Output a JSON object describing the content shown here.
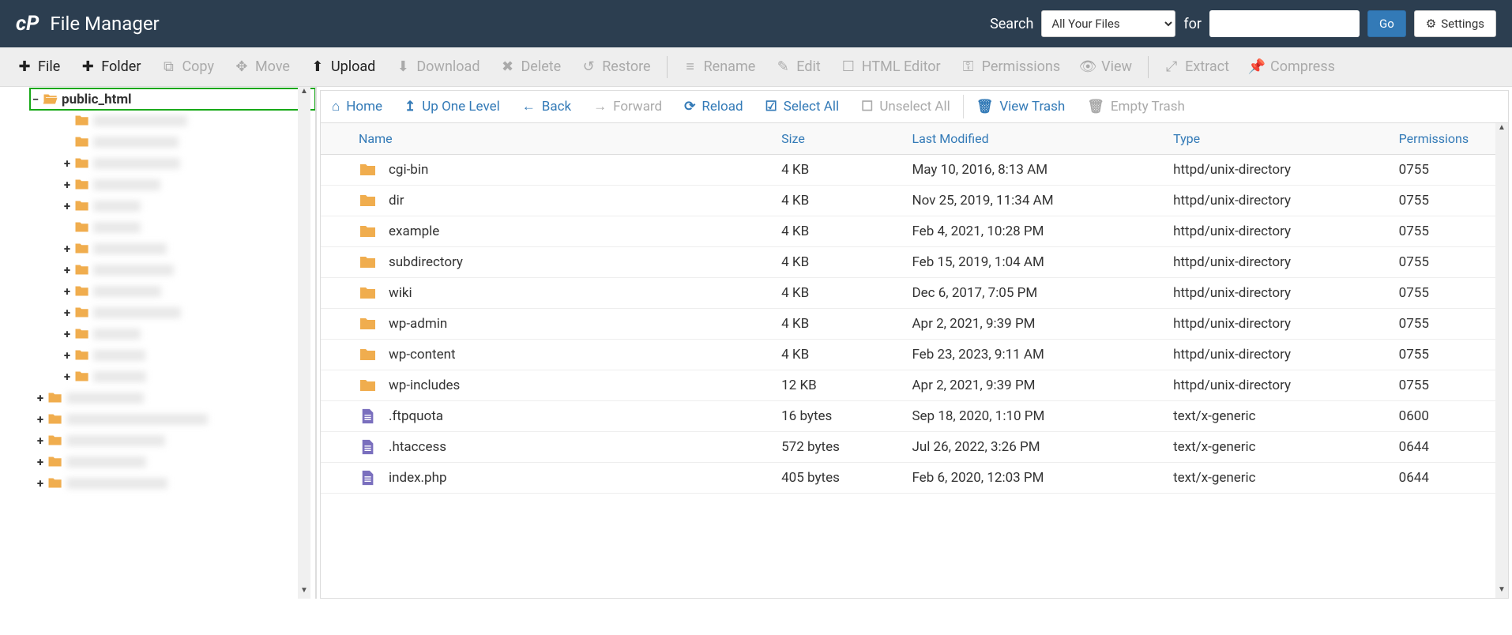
{
  "header": {
    "title": "File Manager",
    "search_label": "Search",
    "for_label": "for",
    "search_value": "",
    "go_label": "Go",
    "settings_label": "Settings",
    "dropdown_selected": "All Your Files"
  },
  "toolbar": [
    {
      "id": "file",
      "label": "File",
      "icon": "plus",
      "enabled": true
    },
    {
      "id": "folder",
      "label": "Folder",
      "icon": "plus",
      "enabled": true
    },
    {
      "id": "copy",
      "label": "Copy",
      "icon": "copy",
      "enabled": false
    },
    {
      "id": "move",
      "label": "Move",
      "icon": "move",
      "enabled": false
    },
    {
      "id": "upload",
      "label": "Upload",
      "icon": "upload",
      "enabled": true
    },
    {
      "id": "download",
      "label": "Download",
      "icon": "download",
      "enabled": false
    },
    {
      "id": "delete",
      "label": "Delete",
      "icon": "delete",
      "enabled": false
    },
    {
      "id": "restore",
      "label": "Restore",
      "icon": "restore",
      "enabled": false
    },
    {
      "id": "sep1",
      "sep": true
    },
    {
      "id": "rename",
      "label": "Rename",
      "icon": "rename",
      "enabled": false
    },
    {
      "id": "edit",
      "label": "Edit",
      "icon": "edit",
      "enabled": false
    },
    {
      "id": "htmleditor",
      "label": "HTML Editor",
      "icon": "html",
      "enabled": false
    },
    {
      "id": "permissions",
      "label": "Permissions",
      "icon": "key",
      "enabled": false
    },
    {
      "id": "view",
      "label": "View",
      "icon": "eye",
      "enabled": false
    },
    {
      "id": "sep2",
      "sep": true
    },
    {
      "id": "extract",
      "label": "Extract",
      "icon": "extract",
      "enabled": false
    },
    {
      "id": "compress",
      "label": "Compress",
      "icon": "compress",
      "enabled": false
    }
  ],
  "tree": {
    "root_label": "public_html",
    "children": [
      {
        "toggle": "",
        "blurred": true
      },
      {
        "toggle": "",
        "blurred": true
      },
      {
        "toggle": "+",
        "blurred": true
      },
      {
        "toggle": "+",
        "blurred": true
      },
      {
        "toggle": "+",
        "blurred": true
      },
      {
        "toggle": "",
        "blurred": true
      },
      {
        "toggle": "+",
        "blurred": true
      },
      {
        "toggle": "+",
        "blurred": true
      },
      {
        "toggle": "+",
        "blurred": true
      },
      {
        "toggle": "+",
        "blurred": true
      },
      {
        "toggle": "+",
        "blurred": true
      },
      {
        "toggle": "+",
        "blurred": true
      },
      {
        "toggle": "+",
        "blurred": true
      }
    ],
    "outside": [
      {
        "toggle": "+",
        "blurred": true
      },
      {
        "toggle": "+",
        "blurred": true
      },
      {
        "toggle": "+",
        "blurred": true
      },
      {
        "toggle": "+",
        "blurred": true
      },
      {
        "toggle": "+",
        "blurred": true
      }
    ]
  },
  "nav": [
    {
      "id": "home",
      "label": "Home",
      "icon": "home",
      "enabled": true
    },
    {
      "id": "up",
      "label": "Up One Level",
      "icon": "up",
      "enabled": true
    },
    {
      "id": "back",
      "label": "Back",
      "icon": "back",
      "enabled": true
    },
    {
      "id": "forward",
      "label": "Forward",
      "icon": "forward",
      "enabled": false
    },
    {
      "id": "reload",
      "label": "Reload",
      "icon": "reload",
      "enabled": true
    },
    {
      "id": "selectall",
      "label": "Select All",
      "icon": "checkbox-on",
      "enabled": true
    },
    {
      "id": "unselectall",
      "label": "Unselect All",
      "icon": "checkbox-off",
      "enabled": false
    },
    {
      "id": "sep",
      "sep": true
    },
    {
      "id": "viewtrash",
      "label": "View Trash",
      "icon": "trash",
      "enabled": true
    },
    {
      "id": "emptytrash",
      "label": "Empty Trash",
      "icon": "trash",
      "enabled": false
    }
  ],
  "columns": {
    "name": "Name",
    "size": "Size",
    "modified": "Last Modified",
    "type": "Type",
    "permissions": "Permissions"
  },
  "files": [
    {
      "icon": "folder",
      "name": "cgi-bin",
      "size": "4 KB",
      "modified": "May 10, 2016, 8:13 AM",
      "type": "httpd/unix-directory",
      "perm": "0755"
    },
    {
      "icon": "folder",
      "name": "dir",
      "size": "4 KB",
      "modified": "Nov 25, 2019, 11:34 AM",
      "type": "httpd/unix-directory",
      "perm": "0755"
    },
    {
      "icon": "folder",
      "name": "example",
      "size": "4 KB",
      "modified": "Feb 4, 2021, 10:28 PM",
      "type": "httpd/unix-directory",
      "perm": "0755"
    },
    {
      "icon": "folder",
      "name": "subdirectory",
      "size": "4 KB",
      "modified": "Feb 15, 2019, 1:04 AM",
      "type": "httpd/unix-directory",
      "perm": "0755"
    },
    {
      "icon": "folder",
      "name": "wiki",
      "size": "4 KB",
      "modified": "Dec 6, 2017, 7:05 PM",
      "type": "httpd/unix-directory",
      "perm": "0755"
    },
    {
      "icon": "folder",
      "name": "wp-admin",
      "size": "4 KB",
      "modified": "Apr 2, 2021, 9:39 PM",
      "type": "httpd/unix-directory",
      "perm": "0755"
    },
    {
      "icon": "folder",
      "name": "wp-content",
      "size": "4 KB",
      "modified": "Feb 23, 2023, 9:11 AM",
      "type": "httpd/unix-directory",
      "perm": "0755"
    },
    {
      "icon": "folder",
      "name": "wp-includes",
      "size": "12 KB",
      "modified": "Apr 2, 2021, 9:39 PM",
      "type": "httpd/unix-directory",
      "perm": "0755"
    },
    {
      "icon": "doc",
      "name": ".ftpquota",
      "size": "16 bytes",
      "modified": "Sep 18, 2020, 1:10 PM",
      "type": "text/x-generic",
      "perm": "0600"
    },
    {
      "icon": "doc",
      "name": ".htaccess",
      "size": "572 bytes",
      "modified": "Jul 26, 2022, 3:26 PM",
      "type": "text/x-generic",
      "perm": "0644"
    },
    {
      "icon": "doc",
      "name": "index.php",
      "size": "405 bytes",
      "modified": "Feb 6, 2020, 12:03 PM",
      "type": "text/x-generic",
      "perm": "0644"
    }
  ]
}
